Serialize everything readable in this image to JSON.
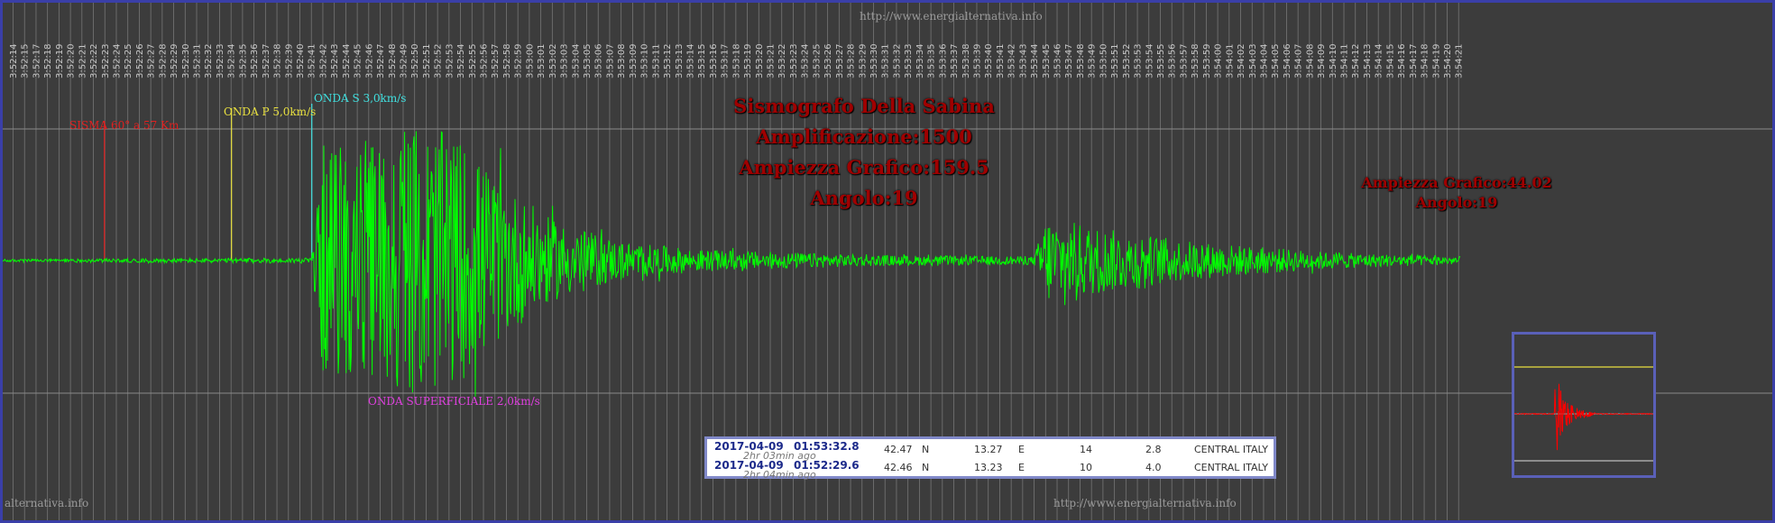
{
  "header": {
    "url_top": "http://www.energialternativa.info"
  },
  "footer": {
    "url_left": "alternativa.info",
    "url_right": "http://www.energialternativa.info"
  },
  "title_block": {
    "lines": [
      "Sismografo Della Sabina",
      "Amplificazione:1500",
      "Ampiezza Grafico:159.5",
      "Angolo:19"
    ]
  },
  "second_block": {
    "lines": [
      "Ampiezza Grafico:44.02",
      "Angolo:19"
    ]
  },
  "markers": {
    "sisma": {
      "label": "SISMA 60° a 57 Km",
      "color": "#e02020"
    },
    "p_wave": {
      "label": "ONDA P 5,0km/s",
      "color": "#e8e040"
    },
    "s_wave": {
      "label": "ONDA S 3,0km/s",
      "color": "#40e0e0"
    },
    "surface_wave": {
      "label": "ONDA SUPERFICIALE 2,0km/s",
      "color": "#e040e0"
    }
  },
  "earthquakes": [
    {
      "date": "2017-04-09",
      "time": "01:53:32.8",
      "ago": "2hr 03min ago",
      "lat": "42.47",
      "lat_dir": "N",
      "lon": "13.27",
      "lon_dir": "E",
      "depth": "14",
      "mag": "2.8",
      "region": "CENTRAL ITALY"
    },
    {
      "date": "2017-04-09",
      "time": "01:52:29.6",
      "ago": "2hr 04min ago",
      "lat": "42.46",
      "lat_dir": "N",
      "lon": "13.23",
      "lon_dir": "E",
      "depth": "10",
      "mag": "4.0",
      "region": "CENTRAL ITALY"
    }
  ],
  "colors": {
    "signal": "#00ff00",
    "background": "#3c3c3c",
    "grid": "#8a8a8a",
    "title": "#a00000",
    "inset_signal": "#ff0000"
  },
  "chart_data": {
    "type": "line",
    "title": "Sismografo Della Sabina",
    "xlabel": "",
    "ylabel": "",
    "x_ticks": [
      "3:52:14",
      "3:52:15",
      "3:52:17",
      "3:52:18",
      "3:52:19",
      "3:52:20",
      "3:52:21",
      "3:52:22",
      "3:52:23",
      "3:52:24",
      "3:52:25",
      "3:52:26",
      "3:52:27",
      "3:52:28",
      "3:52:29",
      "3:52:30",
      "3:52:31",
      "3:52:32",
      "3:52:33",
      "3:52:34",
      "3:52:35",
      "3:52:36",
      "3:52:37",
      "3:52:38",
      "3:52:39",
      "3:52:40",
      "3:52:41",
      "3:52:42",
      "3:52:43",
      "3:52:44",
      "3:52:45",
      "3:52:46",
      "3:52:47",
      "3:52:48",
      "3:52:49",
      "3:52:50",
      "3:52:51",
      "3:52:52",
      "3:52:53",
      "3:52:54",
      "3:52:55",
      "3:52:56",
      "3:52:57",
      "3:52:58",
      "3:52:59",
      "3:53:00",
      "3:53:01",
      "3:53:02",
      "3:53:03",
      "3:53:04",
      "3:53:05",
      "3:53:06",
      "3:53:07",
      "3:53:08",
      "3:53:09",
      "3:53:10",
      "3:53:11",
      "3:53:12",
      "3:53:13",
      "3:53:14",
      "3:53:15",
      "3:53:16",
      "3:53:17",
      "3:53:18",
      "3:53:19",
      "3:53:20",
      "3:53:21",
      "3:53:22",
      "3:53:23",
      "3:53:24",
      "3:53:25",
      "3:53:26",
      "3:53:27",
      "3:53:28",
      "3:53:29",
      "3:53:30",
      "3:53:31",
      "3:53:32",
      "3:53:33",
      "3:53:34",
      "3:53:35",
      "3:53:36",
      "3:53:37",
      "3:53:38",
      "3:53:39",
      "3:53:40",
      "3:53:41",
      "3:53:42",
      "3:53:43",
      "3:53:44",
      "3:53:45",
      "3:53:46",
      "3:53:47",
      "3:53:48",
      "3:53:49",
      "3:53:50",
      "3:53:51",
      "3:53:52",
      "3:53:53",
      "3:53:54",
      "3:53:55",
      "3:53:56",
      "3:53:57",
      "3:53:58",
      "3:53:59",
      "3:54:00",
      "3:54:01",
      "3:54:02",
      "3:54:03",
      "3:54:04",
      "3:54:05",
      "3:54:06",
      "3:54:07",
      "3:54:08",
      "3:54:09",
      "3:54:10",
      "3:54:11",
      "3:54:12",
      "3:54:13",
      "3:54:14",
      "3:54:15",
      "3:54:16",
      "3:54:17",
      "3:54:18",
      "3:54:19",
      "3:54:20",
      "3:54:21"
    ],
    "grid": true,
    "series": [
      {
        "envelope": [
          {
            "t": "3:52:14",
            "amp": 0.01
          },
          {
            "t": "3:52:41",
            "amp": 0.02
          },
          {
            "t": "3:52:42",
            "amp": 0.85
          },
          {
            "t": "3:52:46",
            "amp": 0.9
          },
          {
            "t": "3:52:51",
            "amp": 1.0
          },
          {
            "t": "3:52:54",
            "amp": 0.9
          },
          {
            "t": "3:52:58",
            "amp": 0.55
          },
          {
            "t": "3:53:02",
            "amp": 0.3
          },
          {
            "t": "3:53:08",
            "amp": 0.14
          },
          {
            "t": "3:53:15",
            "amp": 0.08
          },
          {
            "t": "3:53:30",
            "amp": 0.04
          },
          {
            "t": "3:53:44",
            "amp": 0.03
          },
          {
            "t": "3:53:45",
            "amp": 0.33
          },
          {
            "t": "3:53:50",
            "amp": 0.24
          },
          {
            "t": "3:53:58",
            "amp": 0.14
          },
          {
            "t": "3:54:10",
            "amp": 0.06
          },
          {
            "t": "3:54:21",
            "amp": 0.03
          }
        ]
      }
    ],
    "events": [
      {
        "name": "SISMA",
        "t": "3:52:23"
      },
      {
        "name": "ONDA P",
        "t": "3:52:34"
      },
      {
        "name": "ONDA S",
        "t": "3:52:41"
      },
      {
        "name": "ONDA SUPERFICIALE",
        "t": "3:52:42"
      }
    ]
  }
}
